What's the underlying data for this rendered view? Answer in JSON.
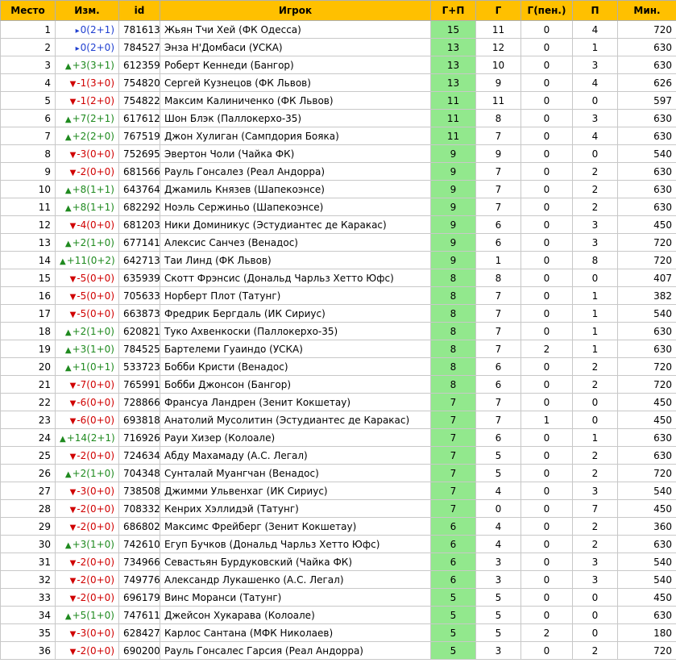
{
  "headers": [
    "Место",
    "Изм.",
    "id",
    "Игрок",
    "Г+П",
    "Г",
    "Г(пен.)",
    "П",
    "Мин."
  ],
  "rows": [
    {
      "place": "1",
      "dir": "eq",
      "change": "0(2+1)",
      "id": "781613",
      "player": "Жьян Тчи Хей (ФК Одесса)",
      "gp": "15",
      "g": "11",
      "pen": "0",
      "p": "4",
      "min": "720"
    },
    {
      "place": "2",
      "dir": "eq",
      "change": "0(2+0)",
      "id": "784527",
      "player": "Энза Н'Домбаси (УСКА)",
      "gp": "13",
      "g": "12",
      "pen": "0",
      "p": "1",
      "min": "630"
    },
    {
      "place": "3",
      "dir": "up",
      "change": "+3(3+1)",
      "id": "612359",
      "player": "Роберт Кеннеди (Бангор)",
      "gp": "13",
      "g": "10",
      "pen": "0",
      "p": "3",
      "min": "630"
    },
    {
      "place": "4",
      "dir": "dn",
      "change": "-1(3+0)",
      "id": "754820",
      "player": "Сергей Кузнецов (ФК Львов)",
      "gp": "13",
      "g": "9",
      "pen": "0",
      "p": "4",
      "min": "626"
    },
    {
      "place": "5",
      "dir": "dn",
      "change": "-1(2+0)",
      "id": "754822",
      "player": "Максим Калиниченко (ФК Львов)",
      "gp": "11",
      "g": "11",
      "pen": "0",
      "p": "0",
      "min": "597"
    },
    {
      "place": "6",
      "dir": "up",
      "change": "+7(2+1)",
      "id": "617612",
      "player": "Шон Блэк (Паллокерхо-35)",
      "gp": "11",
      "g": "8",
      "pen": "0",
      "p": "3",
      "min": "630"
    },
    {
      "place": "7",
      "dir": "up",
      "change": "+2(2+0)",
      "id": "767519",
      "player": "Джон Хулиган (Сампдория Бояка)",
      "gp": "11",
      "g": "7",
      "pen": "0",
      "p": "4",
      "min": "630"
    },
    {
      "place": "8",
      "dir": "dn",
      "change": "-3(0+0)",
      "id": "752695",
      "player": "Эвертон Чоли (Чайка ФК)",
      "gp": "9",
      "g": "9",
      "pen": "0",
      "p": "0",
      "min": "540"
    },
    {
      "place": "9",
      "dir": "dn",
      "change": "-2(0+0)",
      "id": "681566",
      "player": "Рауль Гонсалез (Реал Андорра)",
      "gp": "9",
      "g": "7",
      "pen": "0",
      "p": "2",
      "min": "630"
    },
    {
      "place": "10",
      "dir": "up",
      "change": "+8(1+1)",
      "id": "643764",
      "player": "Джамиль Князев (Шапекоэнсе)",
      "gp": "9",
      "g": "7",
      "pen": "0",
      "p": "2",
      "min": "630"
    },
    {
      "place": "11",
      "dir": "up",
      "change": "+8(1+1)",
      "id": "682292",
      "player": "Ноэль Сержиньо (Шапекоэнсе)",
      "gp": "9",
      "g": "7",
      "pen": "0",
      "p": "2",
      "min": "630"
    },
    {
      "place": "12",
      "dir": "dn",
      "change": "-4(0+0)",
      "id": "681203",
      "player": "Ники Доминикус (Эстудиантес де Каракас)",
      "gp": "9",
      "g": "6",
      "pen": "0",
      "p": "3",
      "min": "450"
    },
    {
      "place": "13",
      "dir": "up",
      "change": "+2(1+0)",
      "id": "677141",
      "player": "Алексис Санчез (Венадос)",
      "gp": "9",
      "g": "6",
      "pen": "0",
      "p": "3",
      "min": "720"
    },
    {
      "place": "14",
      "dir": "up",
      "change": "+11(0+2)",
      "id": "642713",
      "player": "Таи Линд (ФК Львов)",
      "gp": "9",
      "g": "1",
      "pen": "0",
      "p": "8",
      "min": "720"
    },
    {
      "place": "15",
      "dir": "dn",
      "change": "-5(0+0)",
      "id": "635939",
      "player": "Скотт Фрэнсис (Дональд Чарльз Хетто Юфс)",
      "gp": "8",
      "g": "8",
      "pen": "0",
      "p": "0",
      "min": "407"
    },
    {
      "place": "16",
      "dir": "dn",
      "change": "-5(0+0)",
      "id": "705633",
      "player": "Норберт Плот (Татунг)",
      "gp": "8",
      "g": "7",
      "pen": "0",
      "p": "1",
      "min": "382"
    },
    {
      "place": "17",
      "dir": "dn",
      "change": "-5(0+0)",
      "id": "663873",
      "player": "Фредрик Бергдаль (ИК Сириус)",
      "gp": "8",
      "g": "7",
      "pen": "0",
      "p": "1",
      "min": "540"
    },
    {
      "place": "18",
      "dir": "up",
      "change": "+2(1+0)",
      "id": "620821",
      "player": "Туко Ахвенкоски (Паллокерхо-35)",
      "gp": "8",
      "g": "7",
      "pen": "0",
      "p": "1",
      "min": "630"
    },
    {
      "place": "19",
      "dir": "up",
      "change": "+3(1+0)",
      "id": "784525",
      "player": "Бартелеми Гуаиндо (УСКА)",
      "gp": "8",
      "g": "7",
      "pen": "2",
      "p": "1",
      "min": "630"
    },
    {
      "place": "20",
      "dir": "up",
      "change": "+1(0+1)",
      "id": "533723",
      "player": "Бобби Кристи (Венадос)",
      "gp": "8",
      "g": "6",
      "pen": "0",
      "p": "2",
      "min": "720"
    },
    {
      "place": "21",
      "dir": "dn",
      "change": "-7(0+0)",
      "id": "765991",
      "player": "Бобби Джонсон (Бангор)",
      "gp": "8",
      "g": "6",
      "pen": "0",
      "p": "2",
      "min": "720"
    },
    {
      "place": "22",
      "dir": "dn",
      "change": "-6(0+0)",
      "id": "728866",
      "player": "Франсуа Ландрен (Зенит Кокшетау)",
      "gp": "7",
      "g": "7",
      "pen": "0",
      "p": "0",
      "min": "450"
    },
    {
      "place": "23",
      "dir": "dn",
      "change": "-6(0+0)",
      "id": "693818",
      "player": "Анатолий Мусолитин (Эстудиантес де Каракас)",
      "gp": "7",
      "g": "7",
      "pen": "1",
      "p": "0",
      "min": "450"
    },
    {
      "place": "24",
      "dir": "up",
      "change": "+14(2+1)",
      "id": "716926",
      "player": "Рауи Хизер (Колоале)",
      "gp": "7",
      "g": "6",
      "pen": "0",
      "p": "1",
      "min": "630"
    },
    {
      "place": "25",
      "dir": "dn",
      "change": "-2(0+0)",
      "id": "724634",
      "player": "Абду Махамаду (А.С. Легал)",
      "gp": "7",
      "g": "5",
      "pen": "0",
      "p": "2",
      "min": "630"
    },
    {
      "place": "26",
      "dir": "up",
      "change": "+2(1+0)",
      "id": "704348",
      "player": "Сунталай Муангчан (Венадос)",
      "gp": "7",
      "g": "5",
      "pen": "0",
      "p": "2",
      "min": "720"
    },
    {
      "place": "27",
      "dir": "dn",
      "change": "-3(0+0)",
      "id": "738508",
      "player": "Джимми Ульвенхаг (ИК Сириус)",
      "gp": "7",
      "g": "4",
      "pen": "0",
      "p": "3",
      "min": "540"
    },
    {
      "place": "28",
      "dir": "dn",
      "change": "-2(0+0)",
      "id": "708332",
      "player": "Кенрих Хэллидэй (Татунг)",
      "gp": "7",
      "g": "0",
      "pen": "0",
      "p": "7",
      "min": "450"
    },
    {
      "place": "29",
      "dir": "dn",
      "change": "-2(0+0)",
      "id": "686802",
      "player": "Максимс Фрейберг (Зенит Кокшетау)",
      "gp": "6",
      "g": "4",
      "pen": "0",
      "p": "2",
      "min": "360"
    },
    {
      "place": "30",
      "dir": "up",
      "change": "+3(1+0)",
      "id": "742610",
      "player": "Егуп Бучков (Дональд Чарльз Хетто Юфс)",
      "gp": "6",
      "g": "4",
      "pen": "0",
      "p": "2",
      "min": "630"
    },
    {
      "place": "31",
      "dir": "dn",
      "change": "-2(0+0)",
      "id": "734966",
      "player": "Севастьян Бурдуковский (Чайка ФК)",
      "gp": "6",
      "g": "3",
      "pen": "0",
      "p": "3",
      "min": "540"
    },
    {
      "place": "32",
      "dir": "dn",
      "change": "-2(0+0)",
      "id": "749776",
      "player": "Александр Лукашенко (А.С. Легал)",
      "gp": "6",
      "g": "3",
      "pen": "0",
      "p": "3",
      "min": "540"
    },
    {
      "place": "33",
      "dir": "dn",
      "change": "-2(0+0)",
      "id": "696179",
      "player": "Винс Моранси (Татунг)",
      "gp": "5",
      "g": "5",
      "pen": "0",
      "p": "0",
      "min": "450"
    },
    {
      "place": "34",
      "dir": "up",
      "change": "+5(1+0)",
      "id": "747611",
      "player": "Джейсон Хукарава (Колоале)",
      "gp": "5",
      "g": "5",
      "pen": "0",
      "p": "0",
      "min": "630"
    },
    {
      "place": "35",
      "dir": "dn",
      "change": "-3(0+0)",
      "id": "628427",
      "player": "Карлос Сантана (МФК Николаев)",
      "gp": "5",
      "g": "5",
      "pen": "2",
      "p": "0",
      "min": "180"
    },
    {
      "place": "36",
      "dir": "dn",
      "change": "-2(0+0)",
      "id": "690200",
      "player": "Рауль Гонсалес Гарсия (Реал Андорра)",
      "gp": "5",
      "g": "3",
      "pen": "0",
      "p": "2",
      "min": "720"
    }
  ],
  "icons": {
    "up": "triangle-up-icon",
    "dn": "triangle-down-icon",
    "eq": "arrow-right-icon"
  },
  "colors": {
    "header": "#ffc000",
    "gp_cell": "#92e88d",
    "up": "#1f8a1f",
    "down": "#d00000",
    "same": "#1f3fd0"
  }
}
